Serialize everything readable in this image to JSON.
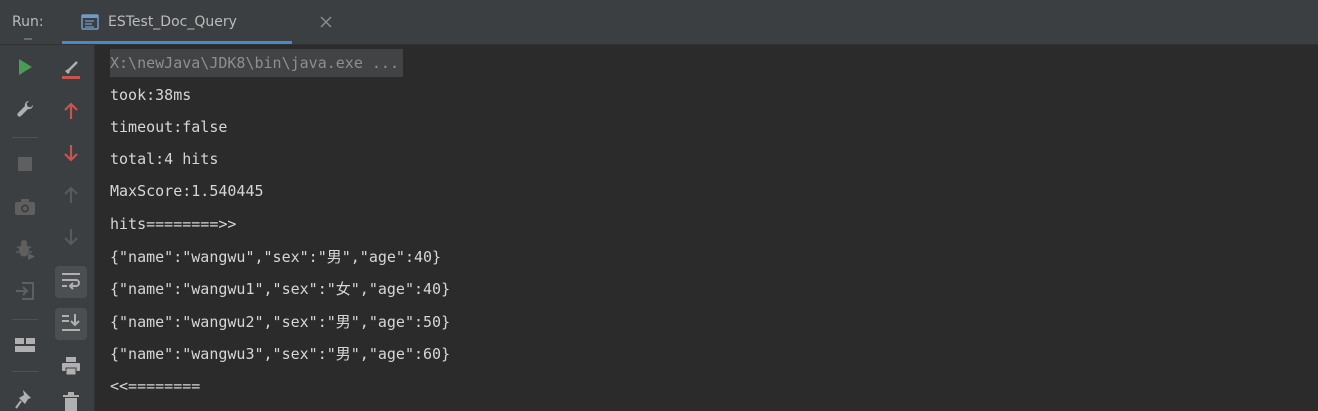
{
  "header": {
    "run_label": "Run:",
    "tab": {
      "label": "ESTest_Doc_Query",
      "icon": "console-tab-icon"
    }
  },
  "toolbar_left": [
    {
      "name": "rerun-icon",
      "color": "#499c54"
    },
    {
      "name": "wrench-icon",
      "color": "#b0b0b0"
    },
    {
      "name": "stop-icon",
      "color": "#6b6b6b"
    },
    {
      "name": "camera-icon",
      "color": "#6b6b6b"
    },
    {
      "name": "debug-icon",
      "color": "#6b6b6b"
    },
    {
      "name": "exit-icon",
      "color": "#6b6b6b"
    },
    {
      "name": "layout-icon",
      "color": "#b0b0b0"
    },
    {
      "name": "pin-icon",
      "color": "#b0b0b0"
    }
  ],
  "toolbar_right": [
    {
      "name": "clear-icon",
      "color": "#c75450"
    },
    {
      "name": "up-arrow-icon",
      "color": "#c75450"
    },
    {
      "name": "down-arrow-icon",
      "color": "#c75450"
    },
    {
      "name": "up-arrow-disabled-icon",
      "color": "#5a5a5a"
    },
    {
      "name": "down-arrow-disabled-icon",
      "color": "#5a5a5a"
    },
    {
      "name": "soft-wrap-icon",
      "color": "#b0b0b0"
    },
    {
      "name": "scroll-to-end-icon",
      "color": "#b0b0b0"
    },
    {
      "name": "print-icon",
      "color": "#b0b0b0"
    },
    {
      "name": "trash-icon",
      "color": "#b0b0b0"
    }
  ],
  "console": {
    "command": "X:\\newJava\\JDK8\\bin\\java.exe ...",
    "lines": [
      "took:38ms",
      "timeout:false",
      "total:4 hits",
      "MaxScore:1.540445",
      "hits========>>",
      "{\"name\":\"wangwu\",\"sex\":\"男\",\"age\":40}",
      "{\"name\":\"wangwu1\",\"sex\":\"女\",\"age\":40}",
      "{\"name\":\"wangwu2\",\"sex\":\"男\",\"age\":50}",
      "{\"name\":\"wangwu3\",\"sex\":\"男\",\"age\":60}",
      "<<========"
    ]
  }
}
